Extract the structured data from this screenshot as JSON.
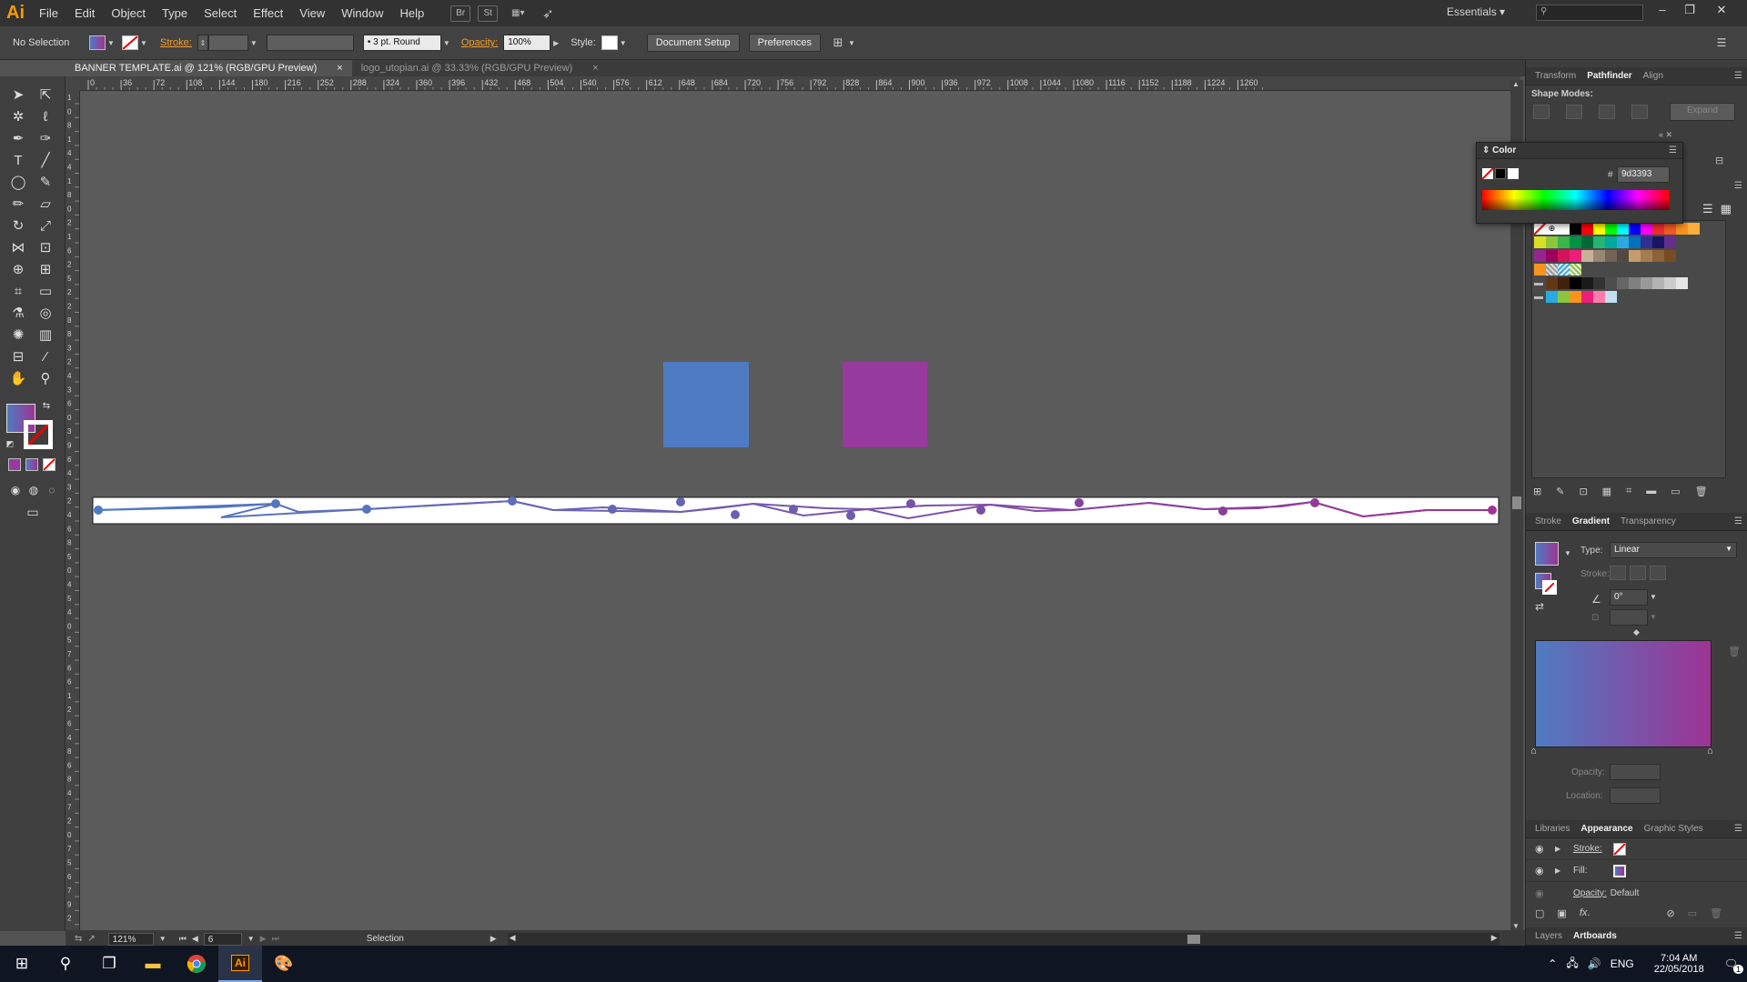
{
  "app": {
    "logo": "Ai",
    "menu": [
      "File",
      "Edit",
      "Object",
      "Type",
      "Select",
      "Effect",
      "View",
      "Window",
      "Help"
    ],
    "toolbar_icons": [
      "Br",
      "St"
    ],
    "workspace": "Essentials",
    "search_placeholder": ""
  },
  "control_bar": {
    "selection_label": "No Selection",
    "stroke_label": "Stroke:",
    "brush_label": "3 pt. Round",
    "opacity_label": "Opacity:",
    "opacity_value": "100%",
    "style_label": "Style:",
    "document_setup": "Document Setup",
    "preferences": "Preferences"
  },
  "tabs": [
    {
      "label": "BANNER TEMPLATE.ai @ 121% (RGB/GPU Preview)",
      "active": true
    },
    {
      "label": "logo_utopian.ai @ 33.33% (RGB/GPU Preview)",
      "active": false
    }
  ],
  "ruler_h_ticks": [
    "0",
    "36",
    "72",
    "108",
    "144",
    "180",
    "216",
    "252",
    "288",
    "324",
    "360",
    "396",
    "432",
    "468",
    "504",
    "540",
    "576",
    "612",
    "648",
    "684",
    "720",
    "756",
    "792",
    "828",
    "864",
    "900",
    "936",
    "972",
    "1008",
    "1044",
    "1080",
    "1116",
    "1152",
    "1188",
    "1224",
    "1260"
  ],
  "ruler_v_ticks": [
    "1",
    "0",
    "8",
    "1",
    "4",
    "4",
    "1",
    "8",
    "0",
    "2",
    "1",
    "6",
    "2",
    "5",
    "2",
    "2",
    "8",
    "8",
    "3",
    "2",
    "4",
    "3",
    "6",
    "0",
    "3",
    "9",
    "6",
    "4",
    "3",
    "2",
    "4",
    "6",
    "8",
    "5",
    "0",
    "4",
    "5",
    "4",
    "0",
    "5",
    "7",
    "6",
    "6",
    "1",
    "2",
    "6",
    "4",
    "8",
    "6",
    "8",
    "4",
    "7",
    "2",
    "0",
    "7",
    "5",
    "6",
    "7",
    "9",
    "2"
  ],
  "canvas": {
    "square_blue_color": "#4f7bc2",
    "square_purple_color": "#973a9d",
    "banner_gradient_start": "#4f7bc2",
    "banner_gradient_end": "#9d3393"
  },
  "status_bar": {
    "zoom": "121%",
    "artboard": "6",
    "tool": "Selection"
  },
  "pathfinder_panel": {
    "tabs": [
      "Transform",
      "Pathfinder",
      "Align"
    ],
    "active_tab": "Pathfinder",
    "shape_modes_label": "Shape Modes:",
    "expand_label": "Expand"
  },
  "color_panel": {
    "title": "Color",
    "hex_label": "#",
    "hex_value": "9d3393"
  },
  "swatches": {
    "row1": [
      "#ffffff",
      "#000000",
      "#ff0000",
      "#ffff00",
      "#00ff00",
      "#00ffff",
      "#0000ff",
      "#ff00ff",
      "#ee2c2c",
      "#f15a24",
      "#f7931e",
      "#fbb03b"
    ],
    "row2": [
      "#d9e021",
      "#8cc63f",
      "#39b54a",
      "#009245",
      "#006837",
      "#22b573",
      "#00a99d",
      "#29abe2",
      "#0071bc",
      "#2e3192",
      "#1b1464",
      "#662d91"
    ],
    "row3": [
      "#93278f",
      "#9e005d",
      "#d4145a",
      "#ed1e79",
      "#c7b299",
      "#998675",
      "#736357",
      "#534741",
      "#c69c6d",
      "#a67c52",
      "#8c6239",
      "#754c24"
    ],
    "row4": [
      "#603813",
      "#42210b",
      "#000000",
      "#1a1a1a",
      "#333333",
      "#4d4d4d",
      "#666666",
      "#808080",
      "#999999",
      "#b3b3b3",
      "#cccccc",
      "#e6e6e6"
    ],
    "row5": [
      "#29abe2",
      "#8cc63f",
      "#f7931e",
      "#ed1e79",
      "#ff7bac",
      "#c2e0f0"
    ]
  },
  "gradient_panel": {
    "tabs": [
      "Stroke",
      "Gradient",
      "Transparency"
    ],
    "active_tab": "Gradient",
    "type_label": "Type:",
    "type_value": "Linear",
    "stroke_label": "Stroke:",
    "angle_value": "0°",
    "opacity_label": "Opacity:",
    "location_label": "Location:",
    "gradient_start": "#4f7bc2",
    "gradient_end": "#9d3393"
  },
  "appearance_panel": {
    "tabs": [
      "Libraries",
      "Appearance",
      "Graphic Styles"
    ],
    "active_tab": "Appearance",
    "stroke_label": "Stroke:",
    "fill_label": "Fill:",
    "opacity_label": "Opacity:",
    "opacity_value": "Default"
  },
  "bottom_panel": {
    "tabs": [
      "Layers",
      "Artboards"
    ],
    "active_tab": "Artboards"
  },
  "taskbar": {
    "time": "7:04 AM",
    "date": "22/05/2018",
    "language": "ENG",
    "notification_count": "1"
  }
}
